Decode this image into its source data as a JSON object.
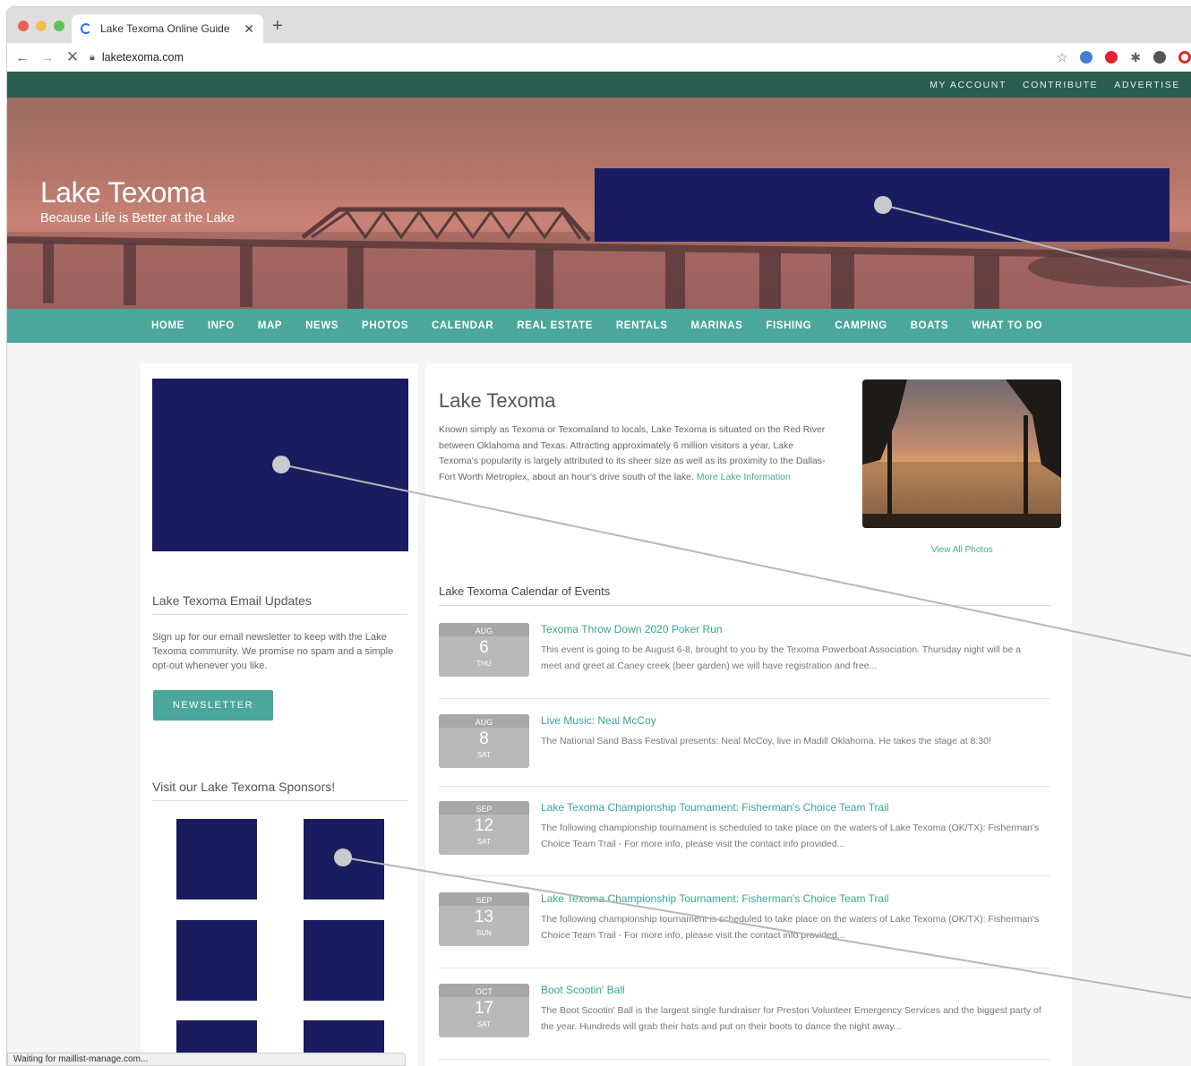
{
  "browser": {
    "tab_title": "Lake Texoma Online Guide",
    "url": "laketexoma.com",
    "status_text": "Waiting for maillist-manage.com..."
  },
  "topbar": {
    "links": [
      "MY ACCOUNT",
      "CONTRIBUTE",
      "ADVERTISE"
    ]
  },
  "hero": {
    "title": "Lake Texoma",
    "tagline": "Because Life is Better at the Lake"
  },
  "mainnav": {
    "items": [
      "HOME",
      "INFO",
      "MAP",
      "NEWS",
      "PHOTOS",
      "CALENDAR",
      "REAL ESTATE",
      "RENTALS",
      "MARINAS",
      "FISHING",
      "CAMPING",
      "BOATS",
      "WHAT TO DO"
    ]
  },
  "sidebar": {
    "email_heading": "Lake Texoma Email Updates",
    "email_text": "Sign up for our email newsletter to keep with the Lake Texoma community. We promise no spam and a simple opt-out whenever you like.",
    "newsletter_button": "NEWSLETTER",
    "sponsors_heading": "Visit our Lake Texoma Sponsors!"
  },
  "main": {
    "title": "Lake Texoma",
    "intro": "Known simply as Texoma or Texomaland to locals, Lake Texoma is situated on the Red River between Oklahoma and Texas. Attracting approximately 6 million visitors a year, Lake Texoma's popularity is largely attributed to its sheer size as well as its proximity to the Dallas-Fort Worth Metroplex, about an hour's drive south of the lake.",
    "more_link": "More Lake Information",
    "view_all_photos": "View All Photos",
    "calendar_heading": "Lake Texoma Calendar of Events",
    "events": [
      {
        "month": "AUG",
        "day": "6",
        "weekday": "THU",
        "title": "Texoma Throw Down 2020 Poker Run",
        "desc": "This event is going to be August 6-8, brought to you by the Texoma Powerboat Association. Thursday night will be a meet and greet at Caney creek (beer garden) we will have registration and free..."
      },
      {
        "month": "AUG",
        "day": "8",
        "weekday": "SAT",
        "title": "Live Music: Neal McCoy",
        "desc": "The National Sand Bass Festival presents: Neal McCoy, live in Madill Oklahoma. He takes the stage at 8:30!"
      },
      {
        "month": "SEP",
        "day": "12",
        "weekday": "SAT",
        "title": "Lake Texoma Championship Tournament: Fisherman's Choice Team Trail",
        "desc": "The following championship tournament is scheduled to take place on the waters of Lake Texoma (OK/TX): Fisherman's Choice Team Trail - For more info, please visit the contact info provided..."
      },
      {
        "month": "SEP",
        "day": "13",
        "weekday": "SUN",
        "title": "Lake Texoma Championship Tournament: Fisherman's Choice Team Trail",
        "desc": "The following championship tournament is scheduled to take place on the waters of Lake Texoma (OK/TX): Fisherman's Choice Team Trail - For more info, please visit the contact info provided..."
      },
      {
        "month": "OCT",
        "day": "17",
        "weekday": "SAT",
        "title": "Boot Scootin' Ball",
        "desc": "The Boot Scootin' Ball is the largest single fundraiser for Preston Volunteer Emergency Services and the biggest party of the year. Hundreds will grab their hats and put on their boots to dance the night away..."
      }
    ]
  },
  "colors": {
    "topbar": "#2a5e50",
    "nav": "#4aa79a",
    "redaction": "#191c5e",
    "link": "#39a593"
  }
}
